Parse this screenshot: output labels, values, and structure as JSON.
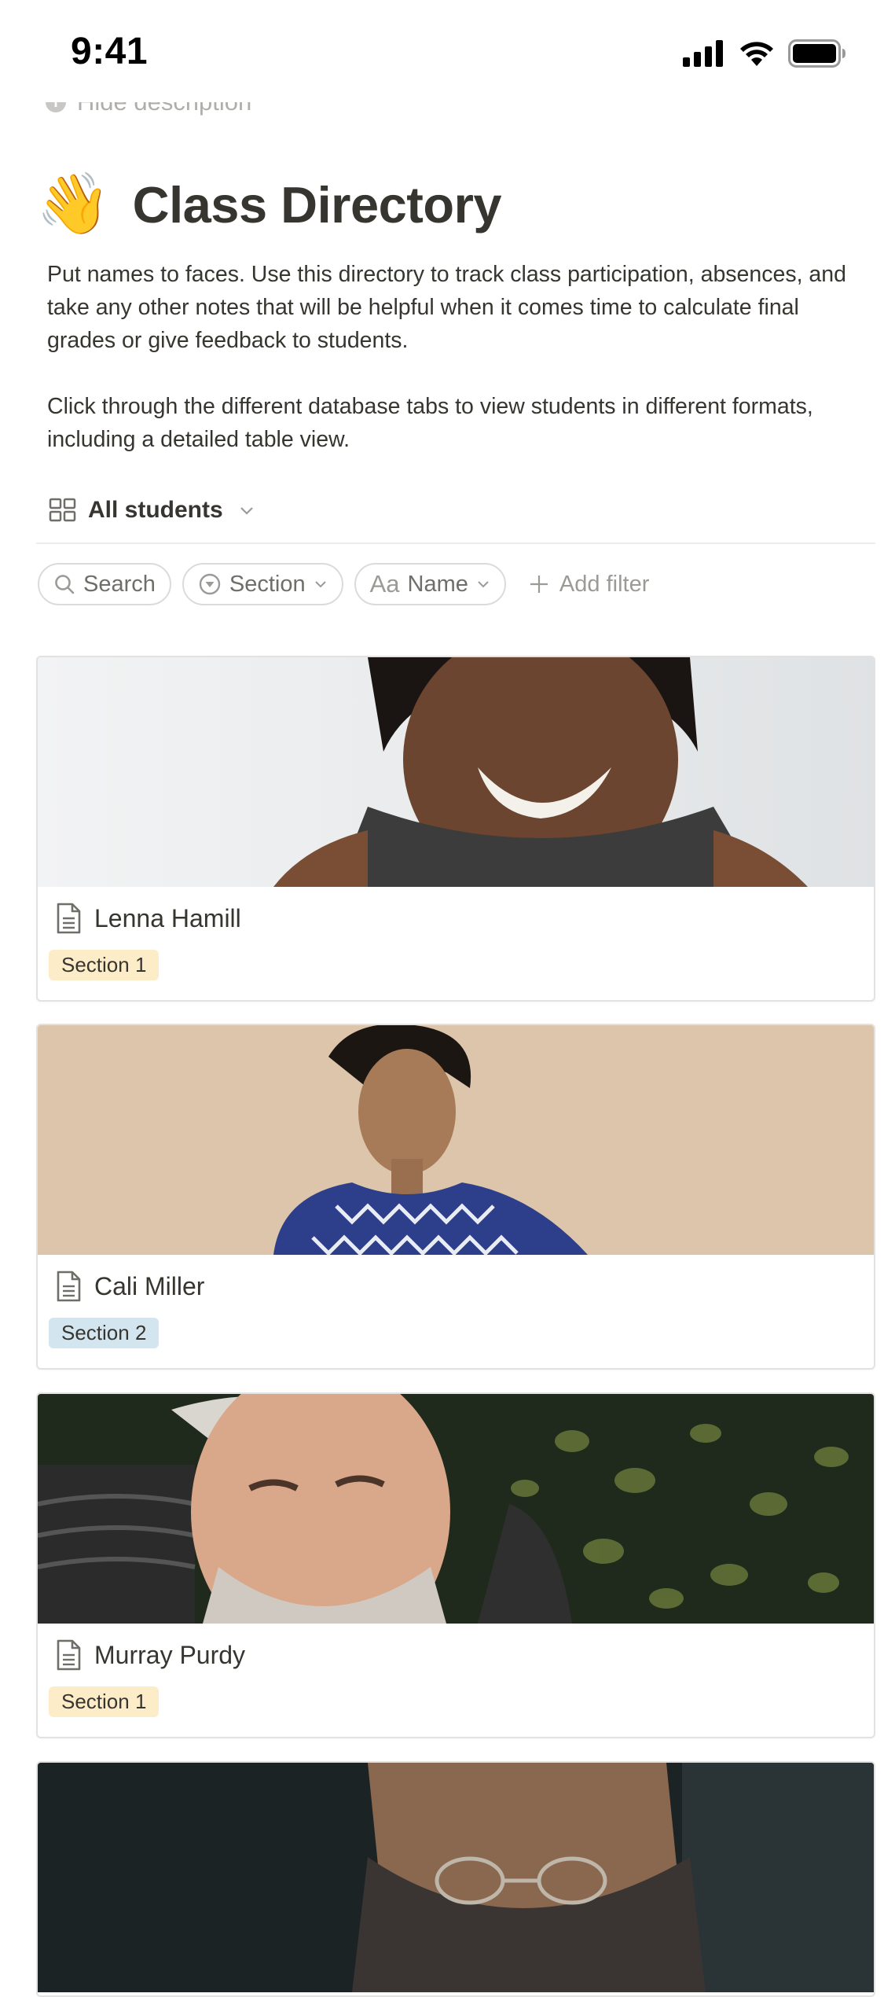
{
  "status_bar": {
    "time": "9:41"
  },
  "header": {
    "hide_description": "Hide description",
    "emoji": "👋",
    "title": "Class Directory",
    "description_p1": "Put names to faces. Use this directory to track class participation, absences, and take any other notes that will be helpful when it comes time to calculate final grades or give feedback to students.",
    "description_p2": "Click through the different database tabs to view students in different formats, including a detailed table view."
  },
  "view": {
    "label": "All students",
    "icon": "gallery-icon"
  },
  "filters": {
    "search_label": "Search",
    "section_label": "Section",
    "name_prefix": "Aa",
    "name_label": "Name",
    "add_filter_label": "Add filter"
  },
  "cards": [
    {
      "name": "Lenna Hamill",
      "section": "Section 1",
      "tag_color": "#fdecc8"
    },
    {
      "name": "Cali Miller",
      "section": "Section 2",
      "tag_color": "#d3e5ef"
    },
    {
      "name": "Murray Purdy",
      "section": "Section 1",
      "tag_color": "#fdecc8"
    },
    {
      "name": "",
      "section": "",
      "tag_color": ""
    }
  ]
}
